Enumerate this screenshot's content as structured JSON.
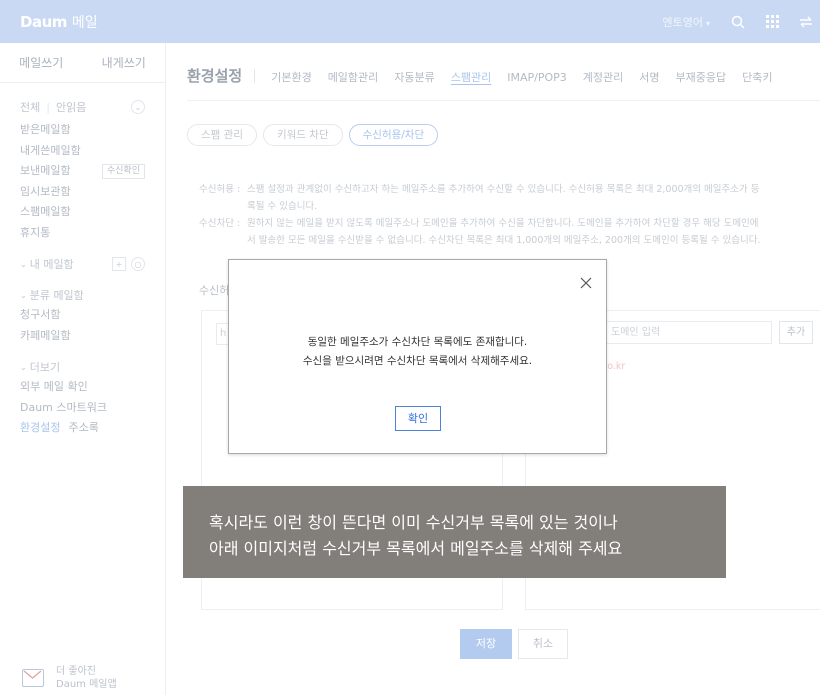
{
  "header": {
    "logo": "Daum",
    "service": "메일",
    "user_name": "엔토영어",
    "bg_color": "#c9d9f3"
  },
  "sidebar": {
    "write_mail": "메일쓰기",
    "write_self": "내게쓰기",
    "all_label": "전체",
    "unread_label": "안읽음",
    "folders": [
      "받은메일함",
      "내게쓴메일함",
      "보낸메일함",
      "임시보관함",
      "스팸메일함",
      "휴지통"
    ],
    "sent_check": "수신확인",
    "my_mailbox": "내 메일함",
    "category_mailbox": "분류 메일함",
    "category_items": [
      "청구서함",
      "카페메일함"
    ],
    "more": "더보기",
    "more_items": [
      "외부 메일 확인",
      "Daum 스마트워크"
    ],
    "settings": "환경설정",
    "address_book": "주소록",
    "promo_line1": "더 좋아진",
    "promo_line2": "Daum 메일앱"
  },
  "main": {
    "title": "환경설정",
    "tabs": [
      "기본환경",
      "메일함관리",
      "자동분류",
      "스팸관리",
      "IMAP/POP3",
      "계정관리",
      "서명",
      "부재중응답",
      "단축키"
    ],
    "active_tab": "스팸관리",
    "chips": [
      "스팸 관리",
      "키워드 차단",
      "수신허용/차단"
    ],
    "desc_allow_label": "수신허용 :",
    "desc_allow_1": "스팸 설정과 관계없이 수신하고자 하는 메일주소를 추가하여 수신할 수 있습니다. 수신허용 목록은 최대 2,000개의 메일주소가 등",
    "desc_allow_2": "록될 수 있습니다.",
    "desc_block_label": "수신차단 :",
    "desc_block_1": "원하지 않는 메일을 받지 않도록 메일주소나 도메인을 추가하여 수신을 차단합니다. 도메인을 추가하여 차단할 경우 해당 도메인에",
    "desc_block_2": "서 발송한 모든 메일을 수신받을 수 없습니다. 수신차단 목록은 최대 1,000개의 메일주소, 200개의 도메인이 등록될 수 있습니다.",
    "section_label": "수신허",
    "input_left_value": "h",
    "domain_placeholder": "도메인 입력",
    "add_button": "추가",
    "red_text": "co.kr",
    "save": "저장",
    "cancel": "취소"
  },
  "modal": {
    "line1": "동일한 메일주소가 수신차단 목록에도 존재합니다.",
    "line2": "수신을 받으시려면 수신차단 목록에서 삭제해주세요.",
    "ok": "확인"
  },
  "caption": {
    "line1": "혹시라도 이런 창이 뜬다면 이미 수신거부 목록에 있는 것이나",
    "line2": "아래 이미지처럼 수신거부 목록에서 메일주소를 삭제해 주세요"
  }
}
